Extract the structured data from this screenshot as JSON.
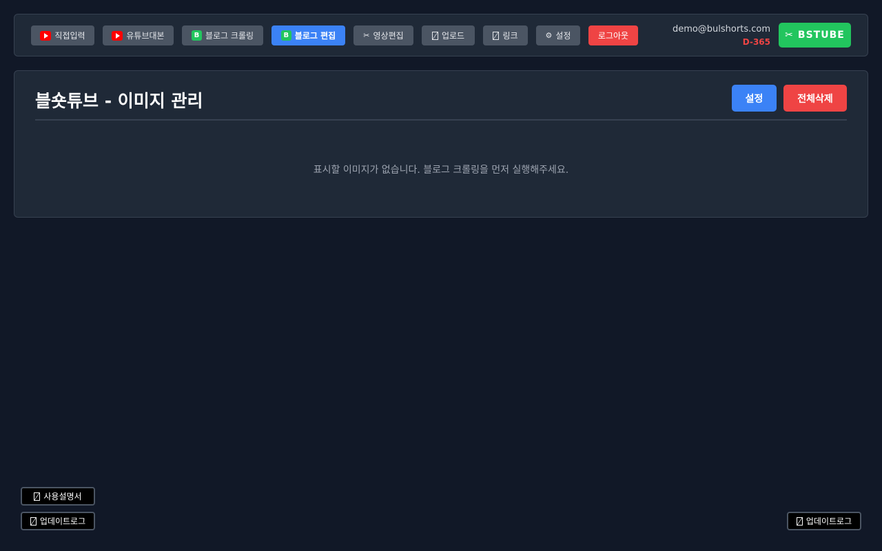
{
  "nav": {
    "items": [
      {
        "label": "직접입력",
        "icon": "youtube-icon"
      },
      {
        "label": "유튜브대본",
        "icon": "youtube-icon"
      },
      {
        "label": "블로그 크롤링",
        "icon": "blog-b-icon",
        "icon_text": "B"
      },
      {
        "label": "블로그 편집",
        "icon": "blog-b-icon",
        "icon_text": "B",
        "active": true
      },
      {
        "label": "영상편집",
        "icon": "scissors-icon",
        "icon_text": "✂"
      },
      {
        "label": "업로드",
        "icon": "upload-icon"
      },
      {
        "label": "링크",
        "icon": "link-icon"
      },
      {
        "label": "설정",
        "icon": "gear-icon",
        "icon_text": "⚙"
      }
    ],
    "logout_label": "로그아웃"
  },
  "user": {
    "email": "demo@bulshorts.com",
    "dday": "D-365"
  },
  "brand": {
    "label": "BSTUBE",
    "icon": "scissors-icon",
    "icon_text": "✂"
  },
  "panel": {
    "title": "블숏튜브 - 이미지 관리",
    "settings_label": "설정",
    "delete_all_label": "전체삭제",
    "empty_message": "표시할 이미지가 없습니다. 블로그 크롤링을 먼저 실행해주세요."
  },
  "footer": {
    "manual_label": "사용설명서",
    "update_log_label": "업데이트로그",
    "update_log_right_label": "업데이트로그"
  },
  "colors": {
    "background": "#111827",
    "panel": "#1f2937",
    "accent": "#3b82f6",
    "danger": "#ef4444",
    "brand": "#22c55e"
  }
}
